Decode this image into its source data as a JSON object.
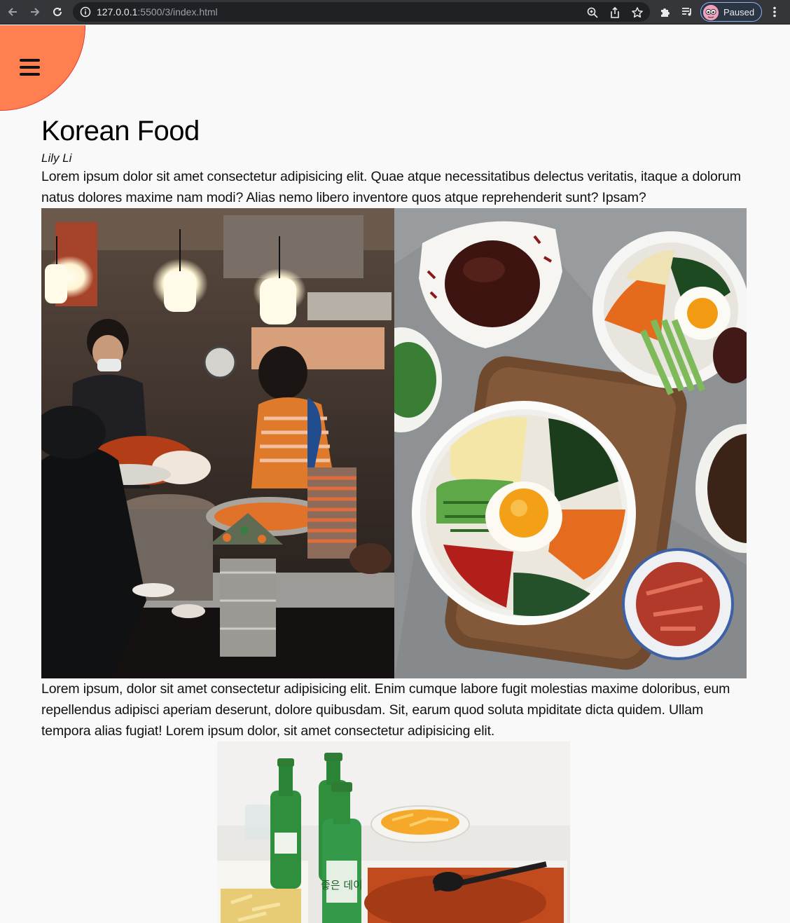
{
  "browser": {
    "url_host": "127.0.0.1",
    "url_path": ":5500/3/index.html",
    "profile_label": "Paused",
    "icons": [
      "back-icon",
      "forward-icon",
      "reload-icon",
      "info-icon",
      "zoom-icon",
      "share-icon",
      "star-icon",
      "extensions-icon",
      "media-icon",
      "avatar-icon",
      "more-icon"
    ]
  },
  "page": {
    "menu_icon": "hamburger-icon",
    "menu_color": "#ff7f50",
    "title": "Korean Food",
    "author": "Lily Li",
    "paragraph1": "Lorem ipsum dolor sit amet consectetur adipisicing elit. Quae atque necessitatibus delectus veritatis, itaque a dolorum natus dolores maxime nam modi? Alias nemo libero inventore quos atque reprehenderit sunt? Ipsam?",
    "paragraph2": "Lorem ipsum, dolor sit amet consectetur adipisicing elit. Enim cumque labore fugit molestias maxime doloribus, eum repellendus adipisci aperiam deserunt, dolore quibusdam. Sit, earum quod soluta mpiditate dicta quidem. Ullam tempora alias fugiat! Lorem ipsum dolor, sit amet consectetur adipisicing elit.",
    "bottle_label": "좋은 데이"
  }
}
